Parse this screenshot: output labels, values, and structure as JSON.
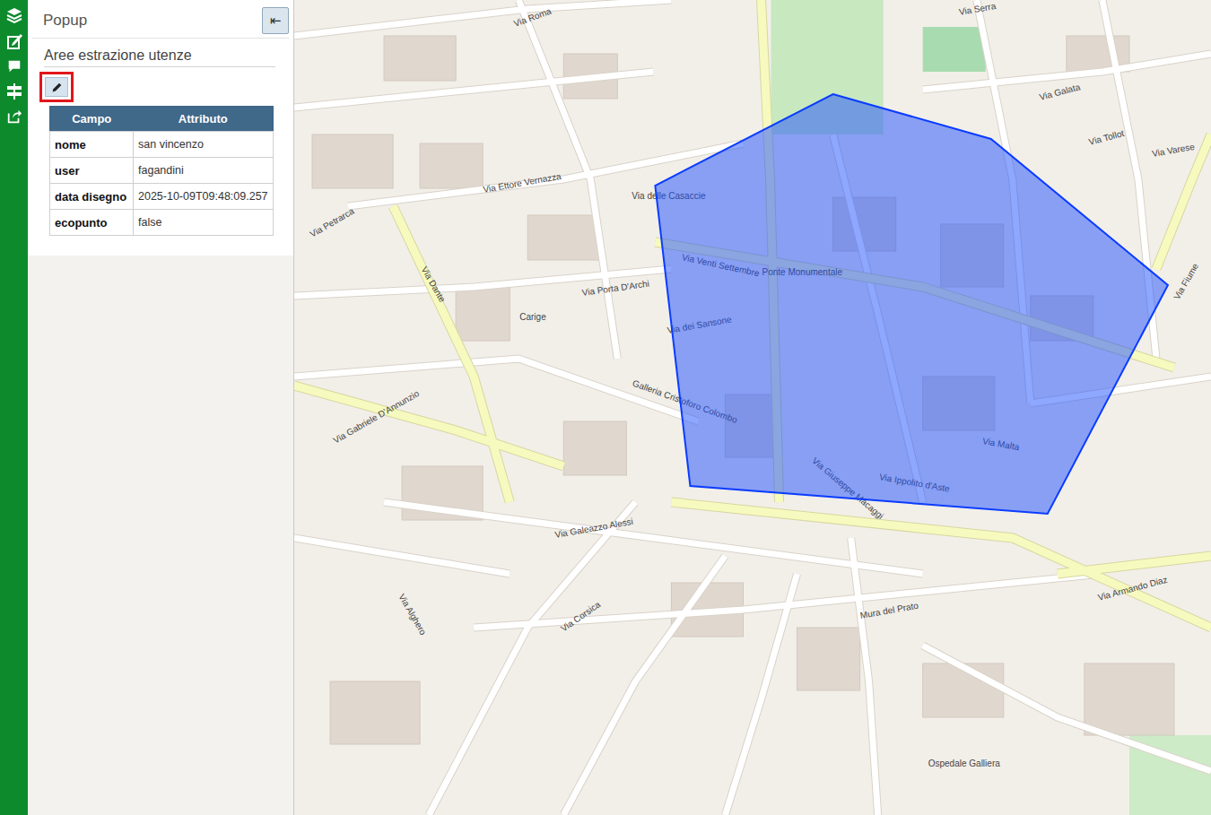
{
  "panel": {
    "title": "Popup",
    "collapse_icon": "⇤",
    "layer_title": "Aree estrazione utenze",
    "edit_button": {
      "highlighted": true
    },
    "table": {
      "columns": [
        "Campo",
        "Attributo"
      ],
      "rows": [
        [
          "nome",
          "san vincenzo"
        ],
        [
          "user",
          "fagandini"
        ],
        [
          "data disegno",
          "2025-10-09T09:48:09.257"
        ],
        [
          "ecopunto",
          "false"
        ]
      ]
    }
  },
  "map": {
    "labels": [
      "Via Roma",
      "Via Serra",
      "Via Galata",
      "Via Tollot",
      "Via Varese",
      "Via Fiume",
      "Via Venti Settembre",
      "Ponte Monumentale",
      "Via Malta",
      "Via Ippolito d'Aste",
      "Via Giuseppe Macaggi",
      "Galleria Cristoforo Colombo",
      "Via Porta D'Archi",
      "Via Ettore Vernazza",
      "Via delle Casaccie",
      "Via Dante",
      "Via Petrarca",
      "Via Gabriele D'Annunzio",
      "Via Galeazzo Alessi",
      "Via Corsica",
      "Via Alghero",
      "Mura del Prato",
      "Via Armando Diaz",
      "Ospedale Galliera",
      "Via dei Sansone",
      "Carige"
    ]
  }
}
